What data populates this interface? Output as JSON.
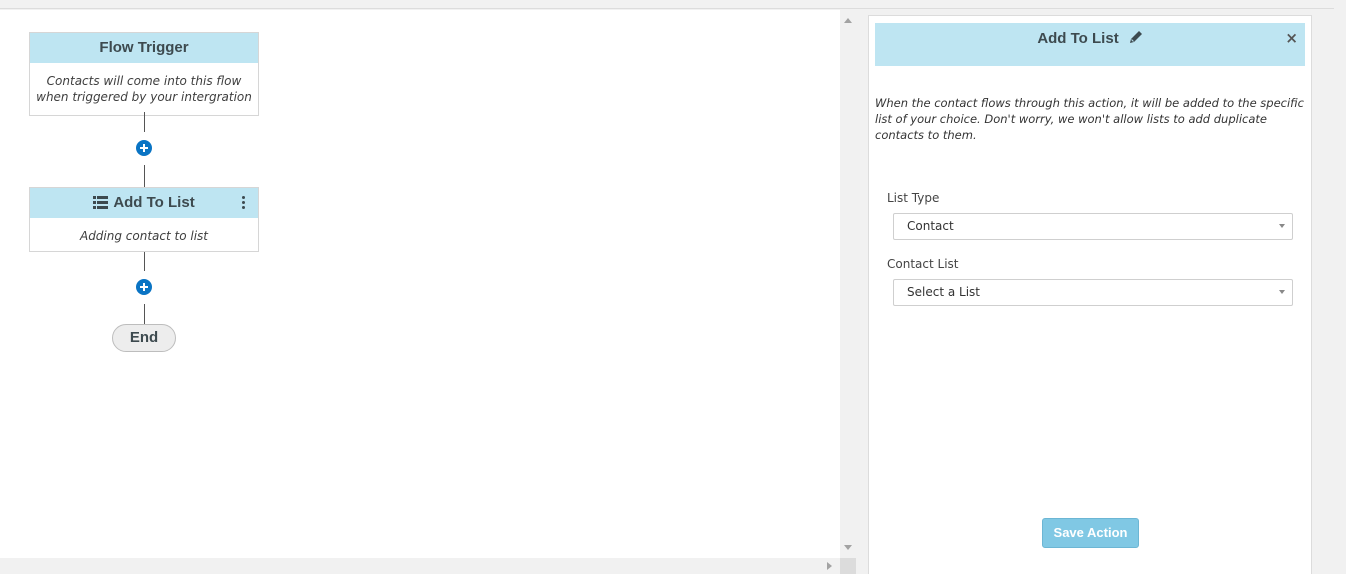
{
  "flow": {
    "trigger": {
      "title": "Flow Trigger",
      "description": "Contacts will come into this flow when triggered by your intergration"
    },
    "action": {
      "icon": "list-icon",
      "title": "Add To List",
      "description": "Adding contact to list"
    },
    "end_label": "End"
  },
  "panel": {
    "title": "Add To List",
    "close_label": "×",
    "description": "When the contact flows through this action, it will be added to the specific list of your choice. Don't worry, we won't allow lists to add duplicate contacts to them.",
    "list_type": {
      "label": "List Type",
      "value": "Contact"
    },
    "contact_list": {
      "label": "Contact List",
      "value": "Select a List"
    },
    "save_label": "Save Action"
  },
  "colors": {
    "header_bg": "#bee5f2",
    "plus_icon": "#0a74c4",
    "save_button": "#80c8e4"
  }
}
